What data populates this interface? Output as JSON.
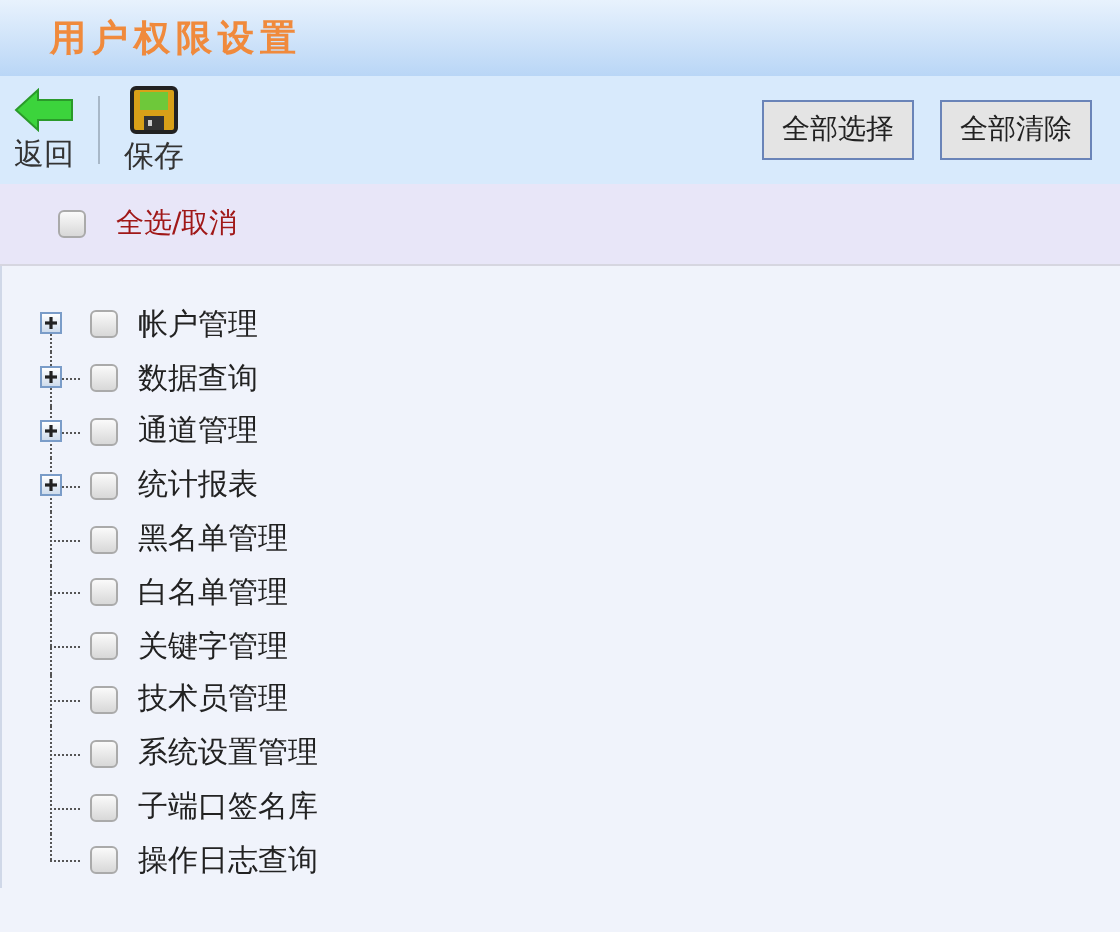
{
  "title": "用户权限设置",
  "toolbar": {
    "back": "返回",
    "save": "保存",
    "buttons": [
      "全部选择",
      "全部清除"
    ]
  },
  "select_all": {
    "label": "全选/取消",
    "checked": false
  },
  "tree": [
    {
      "label": "帐户管理",
      "kind": "folder",
      "expanded": false,
      "checked": false
    },
    {
      "label": "数据查询",
      "kind": "folder",
      "expanded": false,
      "checked": false
    },
    {
      "label": "通道管理",
      "kind": "folder",
      "expanded": false,
      "checked": false
    },
    {
      "label": "统计报表",
      "kind": "folder",
      "expanded": false,
      "checked": false
    },
    {
      "label": "黑名单管理",
      "kind": "leaf",
      "checked": false
    },
    {
      "label": "白名单管理",
      "kind": "leaf",
      "checked": false
    },
    {
      "label": "关键字管理",
      "kind": "leaf",
      "checked": false
    },
    {
      "label": "技术员管理",
      "kind": "leaf",
      "checked": false
    },
    {
      "label": "系统设置管理",
      "kind": "leaf",
      "checked": false
    },
    {
      "label": "子端口签名库",
      "kind": "leaf",
      "checked": false
    },
    {
      "label": "操作日志查询",
      "kind": "leaf",
      "checked": false
    }
  ]
}
